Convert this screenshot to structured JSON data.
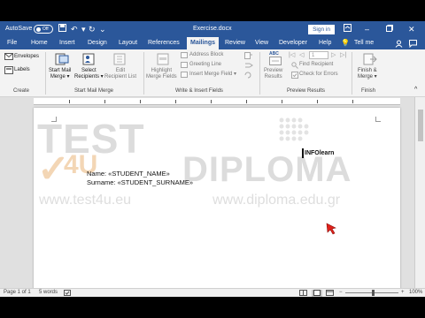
{
  "titlebar": {
    "autosave_label": "AutoSave",
    "autosave_state": "Off",
    "document_title": "Exercise.docx",
    "signin_label": "Sign in",
    "accent_color": "#2b579a"
  },
  "tabs": [
    {
      "label": "File"
    },
    {
      "label": "Home"
    },
    {
      "label": "Insert"
    },
    {
      "label": "Design"
    },
    {
      "label": "Layout"
    },
    {
      "label": "References"
    },
    {
      "label": "Mailings",
      "active": true
    },
    {
      "label": "Review"
    },
    {
      "label": "View"
    },
    {
      "label": "Developer"
    },
    {
      "label": "Help"
    },
    {
      "label": "Tell me"
    }
  ],
  "ribbon": {
    "create": {
      "envelopes": "Envelopes",
      "labels": "Labels",
      "group_label": "Create"
    },
    "start_mail_merge": {
      "start_line1": "Start Mail",
      "start_line2": "Merge",
      "select_line1": "Select",
      "select_line2": "Recipients",
      "edit_line1": "Edit",
      "edit_line2": "Recipient List",
      "group_label": "Start Mail Merge"
    },
    "write_insert": {
      "highlight_line1": "Highlight",
      "highlight_line2": "Merge Fields",
      "address_block": "Address Block",
      "greeting_line": "Greeting Line",
      "insert_merge_field": "Insert Merge Field",
      "group_label": "Write & Insert Fields"
    },
    "preview": {
      "preview_abc": "ABC",
      "preview_line1": "Preview",
      "preview_line2": "Results",
      "record_number": "1",
      "find_recipient": "Find Recipient",
      "check_errors": "Check for Errors",
      "group_label": "Preview Results"
    },
    "finish": {
      "finish_line1": "Finish &",
      "finish_line2": "Merge",
      "group_label": "Finish"
    }
  },
  "document": {
    "watermark": {
      "test": "TEST",
      "four_u": "4U",
      "diploma": "DIPLOMA",
      "url1": "www.test4u.eu",
      "url2": "www.diploma.edu.gr"
    },
    "infolearn": "INFOlearn",
    "name_line": "Name: «STUDENT_NAME»",
    "surname_line": "Surname: «STUDENT_SURNAME»"
  },
  "statusbar": {
    "page": "Page 1 of 1",
    "words": "5 words",
    "zoom": "100%"
  },
  "icons": {
    "save": "save-icon",
    "undo": "undo-icon",
    "redo": "redo-icon",
    "search": "search-icon",
    "cursor": "mouse-pointer-icon"
  }
}
